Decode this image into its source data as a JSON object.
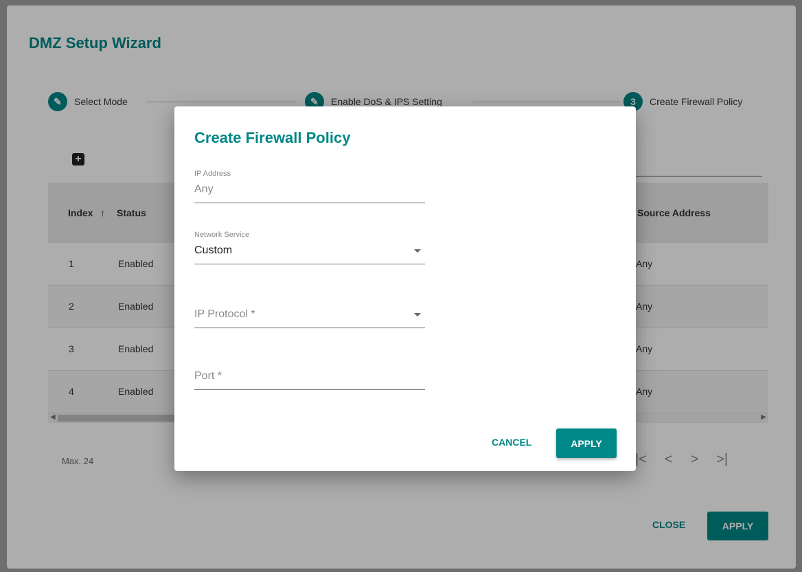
{
  "wizard": {
    "title": "DMZ Setup Wizard",
    "steps": [
      {
        "label": "Select Mode",
        "icon": "pencil-icon",
        "marker": "✎"
      },
      {
        "label": "Enable DoS & IPS Setting",
        "icon": "pencil-icon",
        "marker": "✎"
      },
      {
        "label": "Create Firewall Policy",
        "icon": "step-number",
        "marker": "3"
      }
    ],
    "table": {
      "headers": {
        "index": "Index",
        "status": "Status",
        "source": "Source Address"
      },
      "sort_icon": "↑",
      "rows": [
        {
          "index": "1",
          "status": "Enabled",
          "source": "Any"
        },
        {
          "index": "2",
          "status": "Enabled",
          "source": "Any"
        },
        {
          "index": "3",
          "status": "Enabled",
          "source": "Any"
        },
        {
          "index": "4",
          "status": "Enabled",
          "source": "Any"
        }
      ]
    },
    "max_text": "Max. 24",
    "pager": {
      "first": "|<",
      "prev": "<",
      "next": ">",
      "last": ">|"
    },
    "close_label": "CLOSE",
    "apply_label": "APPLY"
  },
  "modal": {
    "title": "Create Firewall Policy",
    "ip_address": {
      "label": "IP Address",
      "value": "Any"
    },
    "network_service": {
      "label": "Network Service",
      "value": "Custom"
    },
    "ip_protocol": {
      "placeholder": "IP Protocol *"
    },
    "port": {
      "placeholder": "Port *"
    },
    "cancel_label": "CANCEL",
    "apply_label": "APPLY"
  },
  "colors": {
    "accent": "#008787"
  }
}
